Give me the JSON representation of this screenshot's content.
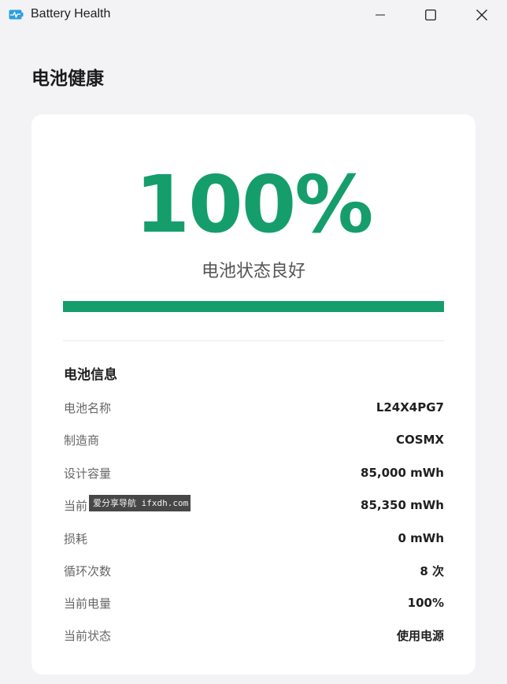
{
  "window": {
    "title": "Battery Health",
    "icon": "battery-heartbeat-icon"
  },
  "page": {
    "title": "电池健康"
  },
  "health": {
    "percent_text": "100%",
    "percent_value": 100,
    "status": "电池状态良好",
    "color": "#159e6c"
  },
  "info": {
    "title": "电池信息",
    "rows": [
      {
        "label": "电池名称",
        "value": "L24X4PG7"
      },
      {
        "label": "制造商",
        "value": "COSMX"
      },
      {
        "label": "设计容量",
        "value": "85,000 mWh"
      },
      {
        "label": "当前",
        "value": "85,350 mWh"
      },
      {
        "label": "损耗",
        "value": "0 mWh"
      },
      {
        "label": "循环次数",
        "value": "8 次"
      },
      {
        "label": "当前电量",
        "value": "100%"
      },
      {
        "label": "当前状态",
        "value": "使用电源"
      }
    ]
  },
  "watermark": {
    "text": "爱分享导航 ifxdh.com"
  }
}
